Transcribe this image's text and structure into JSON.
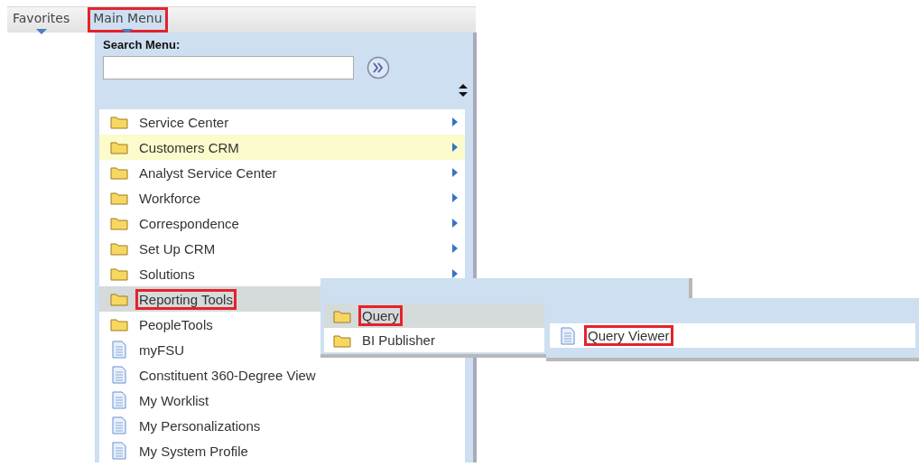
{
  "nav": [
    {
      "label": "Favorites",
      "selected": false,
      "outlined": false
    },
    {
      "label": "Main Menu",
      "selected": true,
      "outlined": true
    }
  ],
  "search": {
    "label": "Search Menu:"
  },
  "menu_items": [
    {
      "label": "Service Center",
      "kind": "folder",
      "has_arrow": true,
      "selected": false,
      "hovered": false,
      "outlined": false
    },
    {
      "label": "Customers CRM",
      "kind": "folder",
      "has_arrow": true,
      "selected": false,
      "hovered": true,
      "outlined": false
    },
    {
      "label": "Analyst Service Center",
      "kind": "folder",
      "has_arrow": true,
      "selected": false,
      "hovered": false,
      "outlined": false
    },
    {
      "label": "Workforce",
      "kind": "folder",
      "has_arrow": true,
      "selected": false,
      "hovered": false,
      "outlined": false
    },
    {
      "label": "Correspondence",
      "kind": "folder",
      "has_arrow": true,
      "selected": false,
      "hovered": false,
      "outlined": false
    },
    {
      "label": "Set Up CRM",
      "kind": "folder",
      "has_arrow": true,
      "selected": false,
      "hovered": false,
      "outlined": false
    },
    {
      "label": "Solutions",
      "kind": "folder",
      "has_arrow": true,
      "selected": false,
      "hovered": false,
      "outlined": false
    },
    {
      "label": "Reporting Tools",
      "kind": "folder",
      "has_arrow": false,
      "selected": true,
      "hovered": false,
      "outlined": true
    },
    {
      "label": "PeopleTools",
      "kind": "folder",
      "has_arrow": false,
      "selected": false,
      "hovered": false,
      "outlined": false
    },
    {
      "label": "myFSU",
      "kind": "page",
      "has_arrow": false,
      "selected": false,
      "hovered": false,
      "outlined": false
    },
    {
      "label": "Constituent 360-Degree View",
      "kind": "page",
      "has_arrow": false,
      "selected": false,
      "hovered": false,
      "outlined": false
    },
    {
      "label": "My Worklist",
      "kind": "page",
      "has_arrow": false,
      "selected": false,
      "hovered": false,
      "outlined": false
    },
    {
      "label": "My Personalizations",
      "kind": "page",
      "has_arrow": false,
      "selected": false,
      "hovered": false,
      "outlined": false
    },
    {
      "label": "My System Profile",
      "kind": "page",
      "has_arrow": false,
      "selected": false,
      "hovered": false,
      "outlined": false
    }
  ],
  "submenu": [
    {
      "label": "Query",
      "kind": "folder",
      "selected": true,
      "outlined": true
    },
    {
      "label": "BI Publisher",
      "kind": "folder",
      "selected": false,
      "outlined": false
    }
  ],
  "submenu_2": [
    {
      "label": "Query Viewer",
      "kind": "page",
      "selected": false,
      "outlined": true
    }
  ]
}
